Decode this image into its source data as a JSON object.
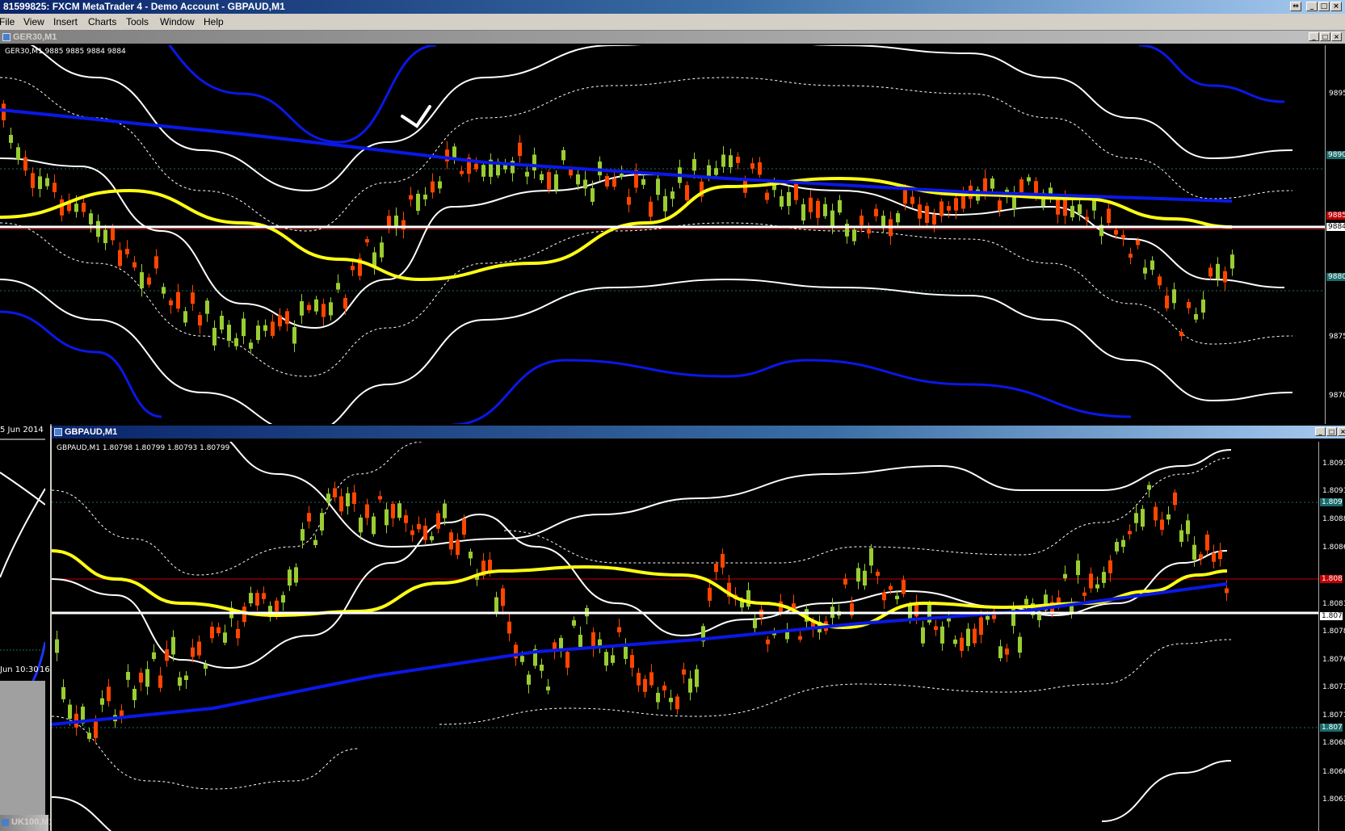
{
  "app": {
    "title": "81599825: FXCM MetaTrader 4 - Demo Account - GBPAUD,M1"
  },
  "menu": {
    "items": [
      "File",
      "View",
      "Insert",
      "Charts",
      "Tools",
      "Window",
      "Help"
    ]
  },
  "window_controls": {
    "restore": "⇔",
    "minimize": "_",
    "maximize": "□",
    "close": "×"
  },
  "ger30": {
    "window_title": "GER30,M1",
    "info": "GER30,M1  9885 9885 9884 9884",
    "bottom_date": "5 Jun 2014",
    "price_labels": [
      "9895",
      "9890",
      "9885",
      "9884",
      "9880",
      "9875",
      "9870"
    ],
    "current_price": "9884",
    "upper_line_label": "9885",
    "colors": {
      "bull": "#9acd32",
      "bear": "#ff4500",
      "ma_blue": "#0a18e6",
      "ma_yellow": "#ffff14"
    }
  },
  "left_window": {
    "date_label": "Jun 10:30",
    "date_label_2": "16"
  },
  "uk100": {
    "window_title": "UK100,M1"
  },
  "gbpaud": {
    "window_title": "GBPAUD,M1",
    "info": "GBPAUD,M1  1.80798 1.80799 1.80793 1.80799",
    "price_labels": [
      "1.8093",
      "1.8091",
      "1.8090",
      "1.8088",
      "1.8086",
      "1.8083",
      "1.8081",
      "1.8079",
      "1.8078",
      "1.8076",
      "1.8073",
      "1.8071",
      "1.8070",
      "1.8068",
      "1.8066",
      "1.8063"
    ],
    "current_price": "1.8079",
    "colors": {
      "bull": "#9acd32",
      "bear": "#ff4500",
      "ma_blue": "#0a18e6",
      "ma_yellow": "#ffff14"
    }
  }
}
